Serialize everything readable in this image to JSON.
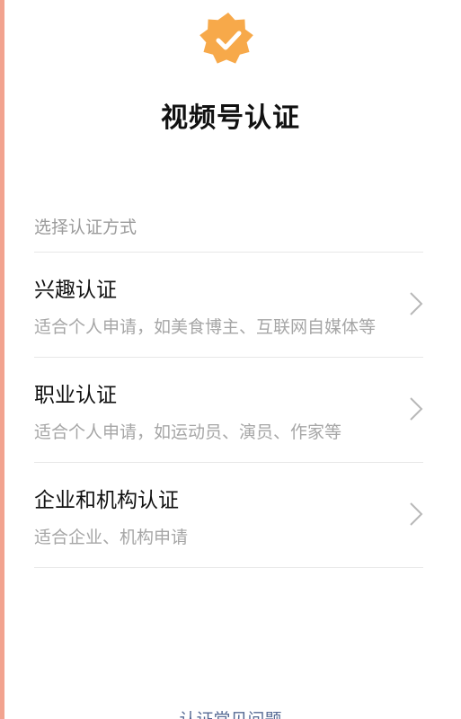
{
  "colors": {
    "accent_left_border": "#f2a38f",
    "badge": "#f7a94a",
    "chevron": "#b8b8b8",
    "link": "#576b95"
  },
  "badge": {
    "icon": "verified-badge-icon"
  },
  "page": {
    "title": "视频号认证"
  },
  "section": {
    "header": "选择认证方式"
  },
  "options": [
    {
      "title": "兴趣认证",
      "description": "适合个人申请，如美食博主、互联网自媒体等",
      "icon": "chevron-right-icon"
    },
    {
      "title": "职业认证",
      "description": "适合个人申请，如运动员、演员、作家等",
      "icon": "chevron-right-icon"
    },
    {
      "title": "企业和机构认证",
      "description": "适合企业、机构申请",
      "icon": "chevron-right-icon"
    }
  ],
  "footer": {
    "link_label": "认证常见问题"
  }
}
